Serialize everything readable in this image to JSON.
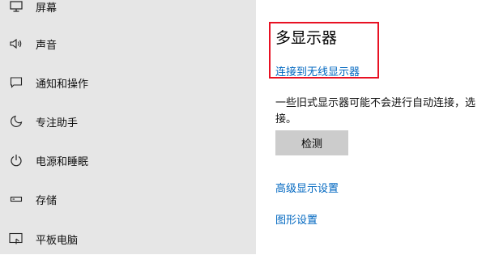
{
  "sidebar": {
    "items": [
      {
        "label": "屏幕",
        "icon": "monitor-icon"
      },
      {
        "label": "声音",
        "icon": "speaker-icon"
      },
      {
        "label": "通知和操作",
        "icon": "message-icon"
      },
      {
        "label": "专注助手",
        "icon": "moon-icon"
      },
      {
        "label": "电源和睡眠",
        "icon": "power-icon"
      },
      {
        "label": "存储",
        "icon": "storage-icon"
      },
      {
        "label": "平板电脑",
        "icon": "tablet-icon"
      }
    ]
  },
  "main": {
    "heading": "多显示器",
    "wireless_link": "连接到无线显示器",
    "description_line1": "一些旧式显示器可能不会进行自动连接，选",
    "description_line2": "接。",
    "detect_button": "检测",
    "advanced_link": "高级显示设置",
    "graphics_link": "图形设置"
  },
  "colors": {
    "sidebar_bg": "#e6e6e6",
    "link": "#0067c0",
    "highlight": "#e81123",
    "button_bg": "#cccccc"
  }
}
